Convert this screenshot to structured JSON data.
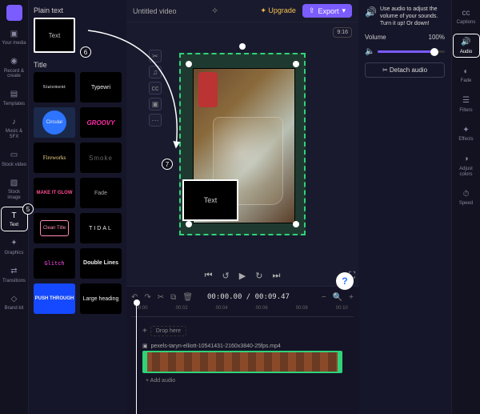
{
  "rail_left": {
    "items": [
      {
        "label": "Your media"
      },
      {
        "label": "Record & create"
      },
      {
        "label": "Templates"
      },
      {
        "label": "Music & SFX"
      },
      {
        "label": "Stock video"
      },
      {
        "label": "Stock image"
      },
      {
        "label": "Text"
      },
      {
        "label": "Graphics"
      },
      {
        "label": "Transitions"
      },
      {
        "label": "Brand kit"
      }
    ]
  },
  "panel": {
    "plain_header": "Plain text",
    "plain_label": "Text",
    "title_header": "Title",
    "tiles": [
      "Statement",
      "Typewri",
      "Circular",
      "GROOVY",
      "Fireworks",
      "Smoke",
      "MAKE IT GLOW",
      "Fade",
      "Clean Title",
      "TIDAL",
      "Glitch",
      "Double Lines",
      "PUSH THROUGH",
      "Large heading"
    ]
  },
  "topbar": {
    "title": "Untitled video",
    "upgrade": "Upgrade",
    "export": "Export",
    "ratio": "9:16"
  },
  "stage": {
    "text_box": "Text"
  },
  "transport": {
    "prev": "⏮",
    "back": "↺",
    "play": "▶",
    "fwd": "↻",
    "next": "⏭",
    "fullscreen": "⛶"
  },
  "timeline": {
    "time": "00:00.00 / 00:09.47",
    "drop": "Drop here",
    "filename": "pexels-taryn-elliott-10541431-2160x3840-25fps.mp4",
    "add_audio": "+ Add audio",
    "ticks": [
      "00:00",
      "00:02",
      "00:04",
      "00:06",
      "00:08",
      "00:10"
    ]
  },
  "right": {
    "tip": "Use audio to adjust the volume of your sounds. Turn it up! Or down!",
    "volume_label": "Volume",
    "volume_value": "100%",
    "detach": "Detach audio"
  },
  "rail_right": {
    "items": [
      {
        "label": "Captions"
      },
      {
        "label": "Audio"
      },
      {
        "label": "Fade"
      },
      {
        "label": "Filters"
      },
      {
        "label": "Effects"
      },
      {
        "label": "Adjust colors"
      },
      {
        "label": "Speed"
      }
    ]
  },
  "annotations": {
    "five": "5",
    "six": "6",
    "seven": "7"
  }
}
